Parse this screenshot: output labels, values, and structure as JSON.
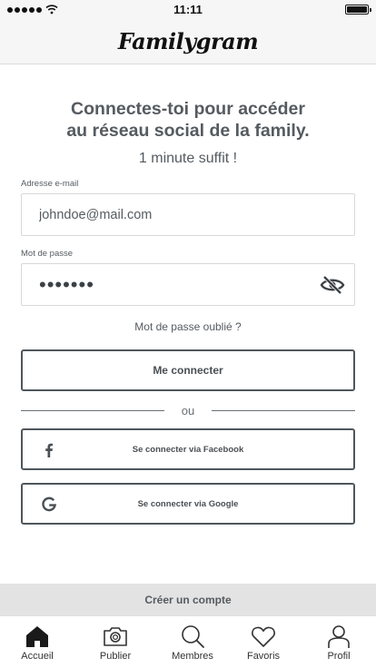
{
  "status_bar": {
    "time": "11:11",
    "signal_icon": "signal-dots-icon",
    "wifi_icon": "wifi-icon",
    "battery_icon": "battery-full-icon"
  },
  "header": {
    "logo_text": "Familygram"
  },
  "intro": {
    "headline_line1": "Connectes-toi pour accéder",
    "headline_line2": "au réseau social de la family.",
    "subline": "1 minute suffit !"
  },
  "form": {
    "email_label": "Adresse e-mail",
    "email_value": "johndoe@mail.com",
    "password_label": "Mot de passe",
    "password_value": "•••••••",
    "toggle_visibility_icon": "eye-off-icon",
    "forgot_link": "Mot de passe oublié ?",
    "submit_label": "Me connecter"
  },
  "divider_label": "ou",
  "social": {
    "facebook_label": "Se connecter via Facebook",
    "facebook_icon": "facebook-icon",
    "google_label": "Se connecter via Google",
    "google_icon": "google-icon"
  },
  "create_account_label": "Créer un compte",
  "tabs": [
    {
      "label": "Accueil",
      "icon": "home-icon"
    },
    {
      "label": "Publier",
      "icon": "camera-icon"
    },
    {
      "label": "Membres",
      "icon": "search-icon"
    },
    {
      "label": "Favoris",
      "icon": "heart-icon"
    },
    {
      "label": "Profil",
      "icon": "user-icon"
    }
  ],
  "colors": {
    "text": "#555b60",
    "border": "#4f565c",
    "bar": "#e3e3e3"
  }
}
